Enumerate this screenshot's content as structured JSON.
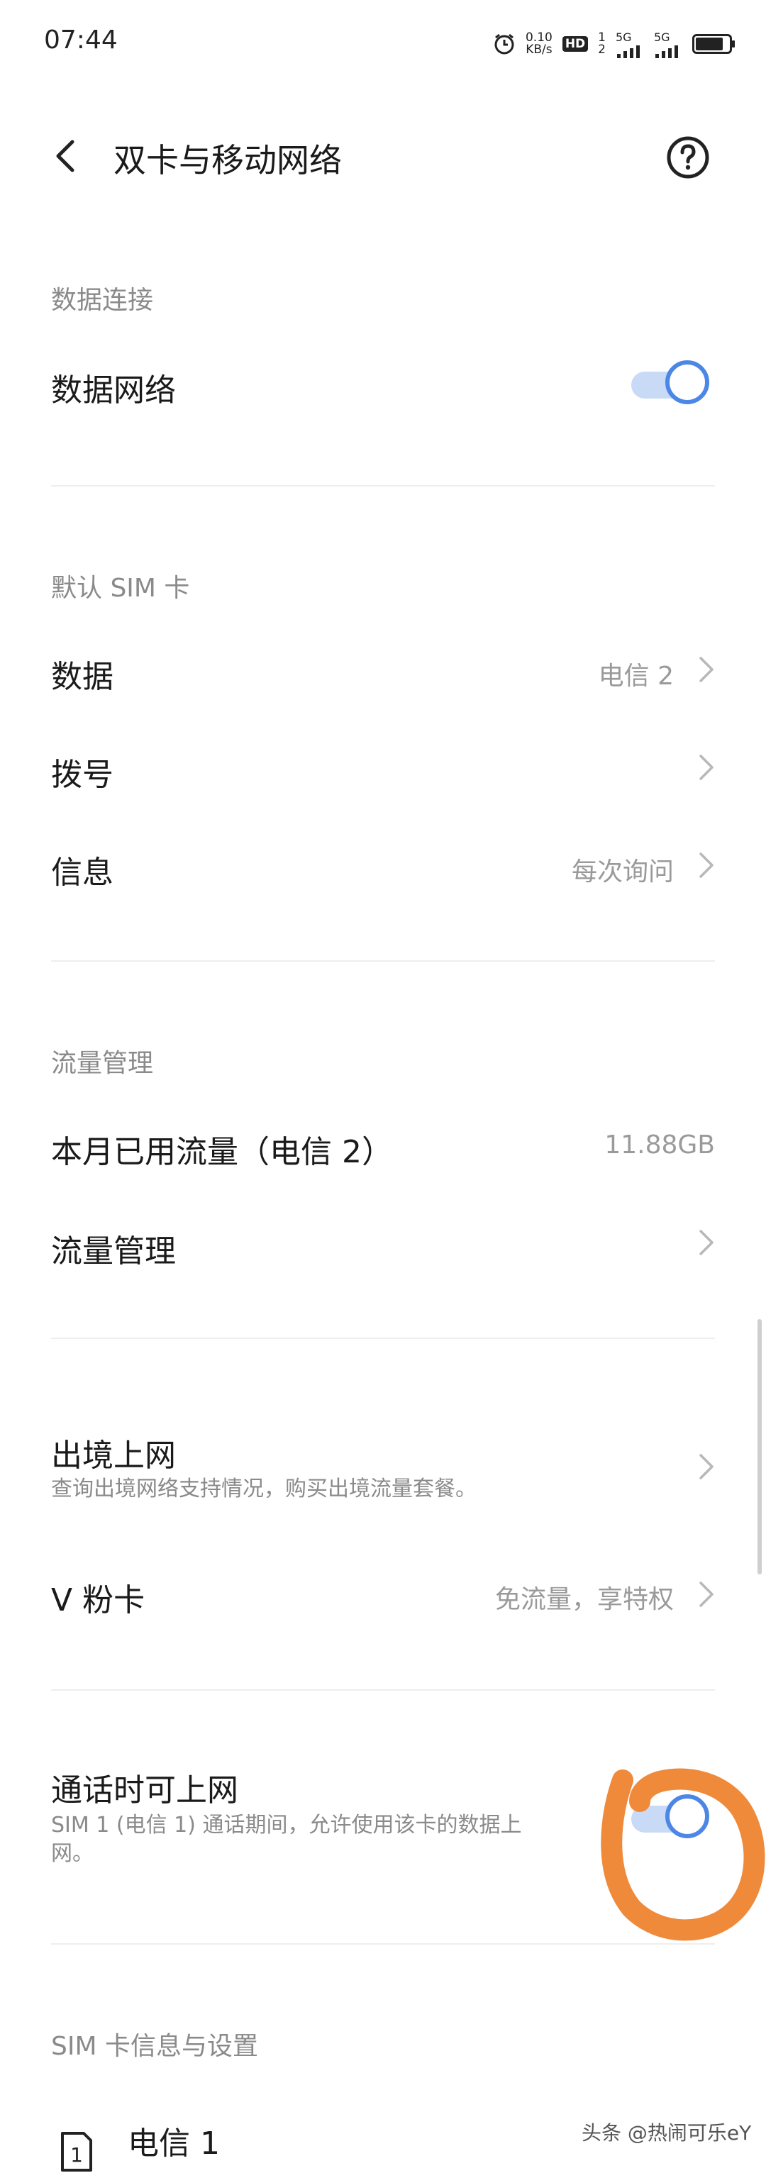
{
  "status": {
    "time": "07:44",
    "net_speed": "0.10",
    "net_unit": "KB/s",
    "hd": "HD",
    "sim_index": "1",
    "sim_index2": "2",
    "sig1": "5G",
    "sig2": "5G"
  },
  "header": {
    "title": "双卡与移动网络"
  },
  "data_connection": {
    "section": "数据连接",
    "mobile_data": {
      "label": "数据网络",
      "enabled": true
    }
  },
  "default_sim": {
    "section": "默认 SIM 卡",
    "data": {
      "label": "数据",
      "value": "电信 2"
    },
    "call": {
      "label": "拨号",
      "value": ""
    },
    "sms": {
      "label": "信息",
      "value": "每次询问"
    }
  },
  "traffic": {
    "section": "流量管理",
    "used": {
      "label": "本月已用流量（电信 2）",
      "value": "11.88GB"
    },
    "manage": {
      "label": "流量管理"
    }
  },
  "roaming": {
    "title": "出境上网",
    "subtitle": "查询出境网络支持情况，购买出境流量套餐。"
  },
  "vfan": {
    "label": "V 粉卡",
    "value": "免流量，享特权"
  },
  "call_data": {
    "title": "通话时可上网",
    "subtitle_line1": "SIM 1 (电信 1) 通话期间，允许使用该卡的数据上",
    "subtitle_line2": "网。",
    "enabled": true
  },
  "sim_info": {
    "section": "SIM 卡信息与设置",
    "sim1": {
      "label": "电信 1",
      "slot": "1"
    }
  },
  "watermark": "头条 @热闹可乐eY",
  "colors": {
    "accent": "#4c86e6",
    "toggle_track": "#c9daf6",
    "annotation": "#ef8a3b"
  }
}
